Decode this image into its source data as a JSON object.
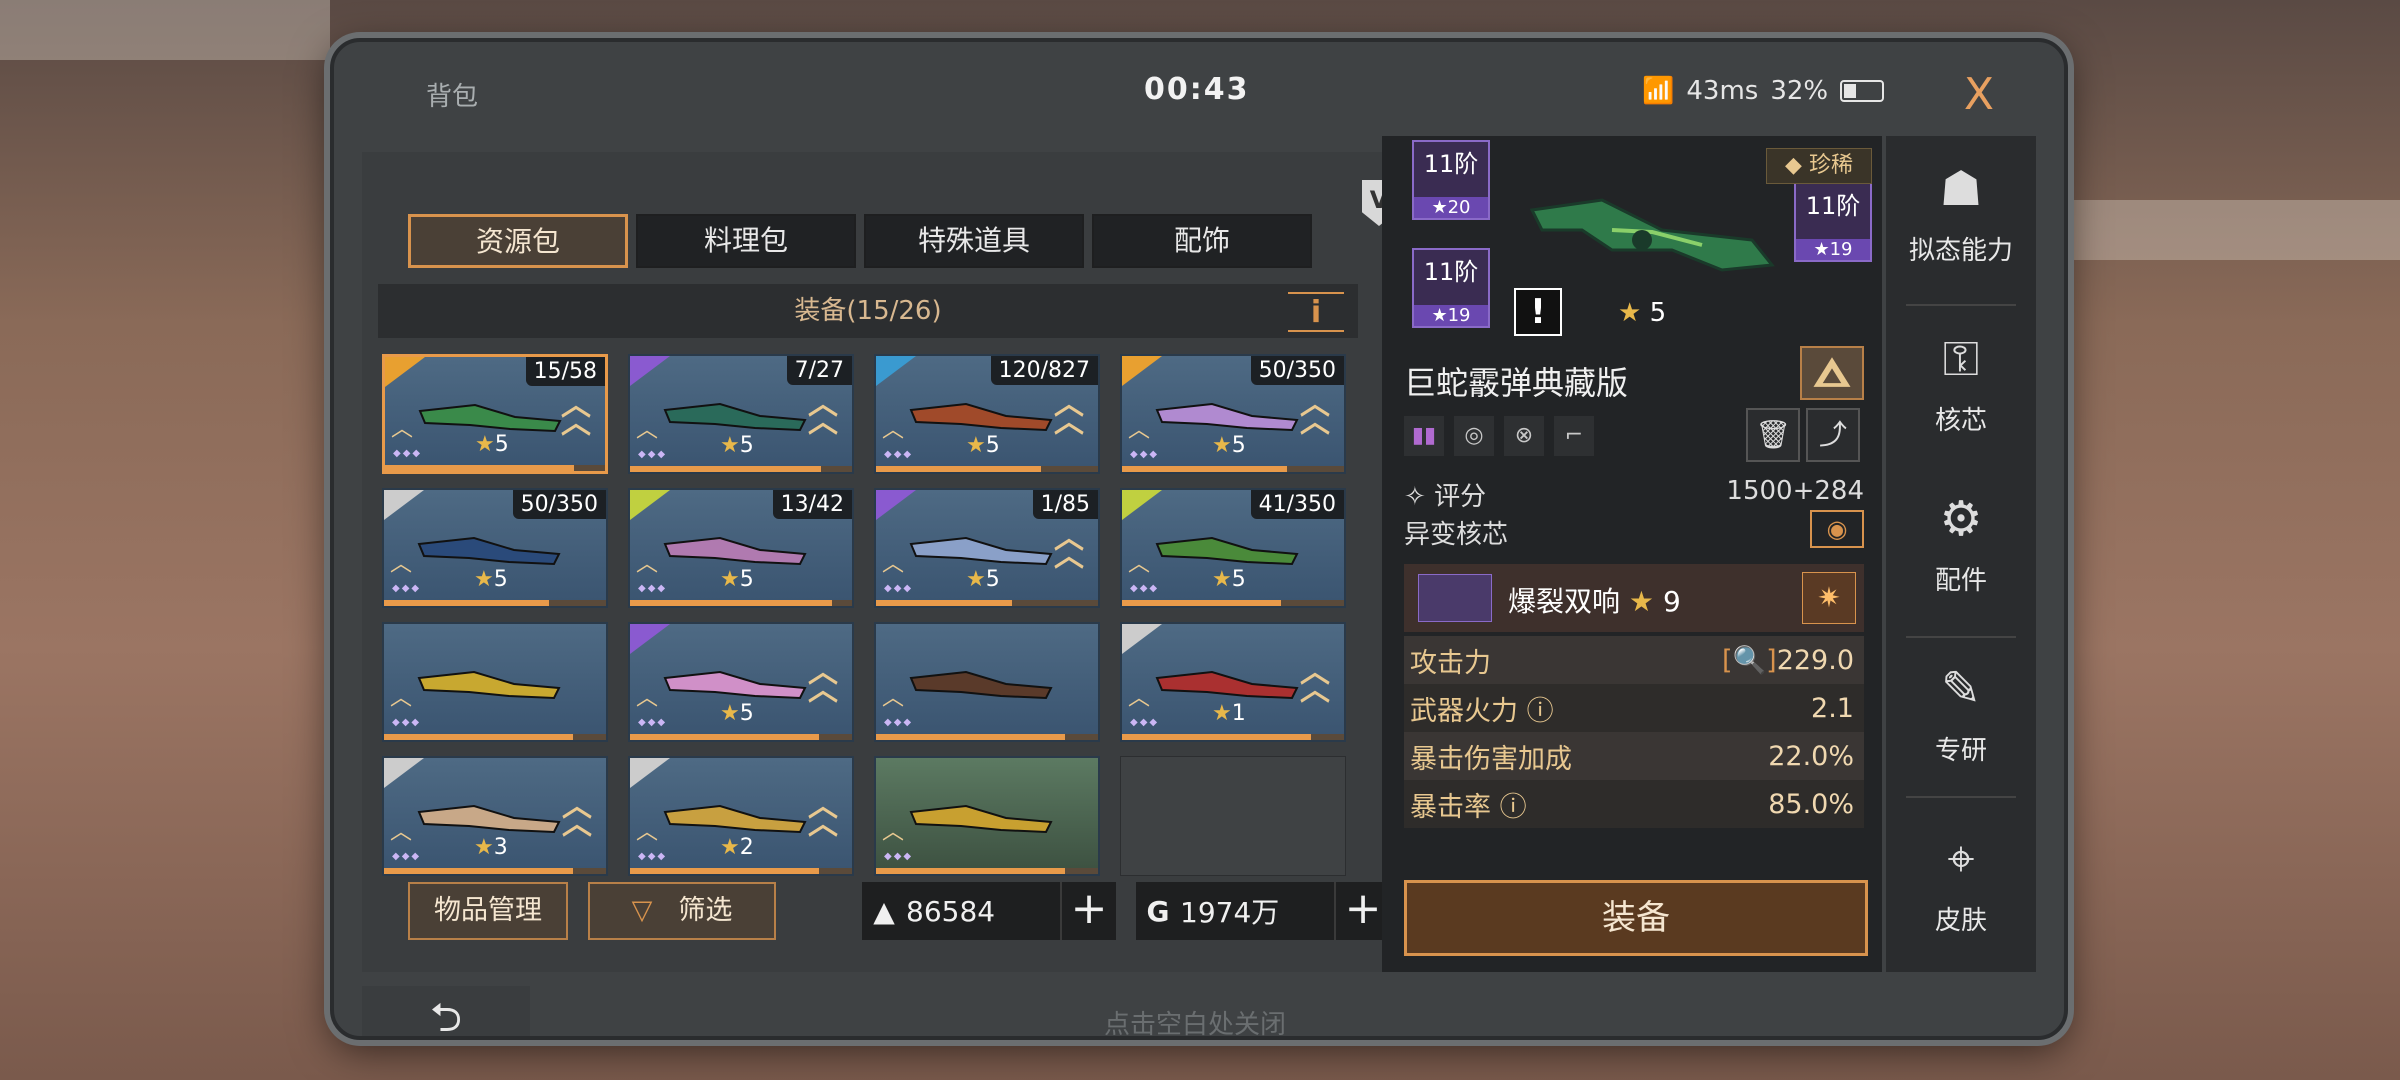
{
  "header": {
    "title": "背包",
    "timer": "00:43",
    "ping": "43ms",
    "battery": "32%",
    "battery_level": 0.32,
    "close_label": "X"
  },
  "tabs": [
    {
      "label": "资源包",
      "active": true
    },
    {
      "label": "料理包",
      "active": false
    },
    {
      "label": "特殊道具",
      "active": false
    },
    {
      "label": "配饰",
      "active": false
    }
  ],
  "v_badge": "V",
  "section": {
    "title": "装备(15/26)",
    "info_label": "i"
  },
  "items": [
    {
      "count": "15/58",
      "stars": "5",
      "rarity_color": "#e8a030",
      "weapon_color": "#3a8a4a",
      "selected": true,
      "chevron": true
    },
    {
      "count": "7/27",
      "stars": "5",
      "rarity_color": "#8a5ad0",
      "weapon_color": "#2a6a5a",
      "selected": false,
      "chevron": true
    },
    {
      "count": "120/827",
      "stars": "5",
      "rarity_color": "#3a9ad0",
      "weapon_color": "#a04a2a",
      "selected": false,
      "chevron": true
    },
    {
      "count": "50/350",
      "stars": "5",
      "rarity_color": "#e8a030",
      "weapon_color": "#b08ad0",
      "selected": false,
      "chevron": true
    },
    {
      "count": "50/350",
      "stars": "5",
      "rarity_color": "#cccccc",
      "weapon_color": "#2a4a7a",
      "selected": false,
      "chevron": false
    },
    {
      "count": "13/42",
      "stars": "5",
      "rarity_color": "#c0d040",
      "weapon_color": "#b07ab0",
      "selected": false,
      "chevron": false
    },
    {
      "count": "1/85",
      "stars": "5",
      "rarity_color": "#8a5ad0",
      "weapon_color": "#8aa0c8",
      "selected": false,
      "chevron": true
    },
    {
      "count": "41/350",
      "stars": "5",
      "rarity_color": "#c0d040",
      "weapon_color": "#4a8a3a",
      "selected": false,
      "chevron": false
    },
    {
      "count": "",
      "stars": "",
      "rarity_color": "",
      "weapon_color": "#c8a830",
      "selected": false,
      "chevron": false
    },
    {
      "count": "",
      "stars": "5",
      "rarity_color": "#8a5ad0",
      "weapon_color": "#d090c8",
      "selected": false,
      "chevron": true
    },
    {
      "count": "",
      "stars": "",
      "rarity_color": "",
      "weapon_color": "#5a3a2a",
      "selected": false,
      "chevron": false
    },
    {
      "count": "",
      "stars": "1",
      "rarity_color": "#cccccc",
      "weapon_color": "#aa3030",
      "selected": false,
      "chevron": true
    },
    {
      "count": "",
      "stars": "3",
      "rarity_color": "#cccccc",
      "weapon_color": "#c8a888",
      "selected": false,
      "chevron": true
    },
    {
      "count": "",
      "stars": "2",
      "rarity_color": "#cccccc",
      "weapon_color": "#c8a040",
      "selected": false,
      "chevron": true
    },
    {
      "count": "",
      "stars": "",
      "rarity_color": "",
      "weapon_color": "#c8a030",
      "selected": false,
      "chevron": false,
      "green": true
    },
    {
      "count": "",
      "stars": "",
      "rarity_color": "",
      "weapon_color": "",
      "selected": false,
      "chevron": false,
      "empty": true
    }
  ],
  "bottom_left": {
    "manage_label": "物品管理",
    "filter_label": "筛选",
    "currency1": "86584",
    "currency2": "1974万",
    "currency2_icon": "G"
  },
  "detail": {
    "tiers": [
      {
        "label": "11阶",
        "stars": "20"
      },
      {
        "label": "11阶",
        "stars": "19"
      },
      {
        "label": "11阶",
        "stars": "19"
      }
    ],
    "rarity_label": "珍稀",
    "stars": "5",
    "name": "巨蛇霰弹典藏版",
    "score_label": "评分",
    "score_value": "1500+284",
    "mutation_label": "异变核芯",
    "core_name": "爆裂双响",
    "core_stars": "9",
    "stats": [
      {
        "label": "攻击力",
        "value": "229.0"
      },
      {
        "label": "武器火力",
        "value": "2.1"
      },
      {
        "label": "暴击伤害加成",
        "value": "22.0%"
      },
      {
        "label": "暴击率",
        "value": "85.0%"
      }
    ],
    "equip_label": "装备"
  },
  "side_nav": [
    {
      "label": "拟态能力"
    },
    {
      "label": "核芯"
    },
    {
      "label": "配件"
    },
    {
      "label": "专研"
    },
    {
      "label": "皮肤"
    }
  ],
  "footer": {
    "hint": "点击空白处关闭",
    "back_icon": "⮌"
  }
}
